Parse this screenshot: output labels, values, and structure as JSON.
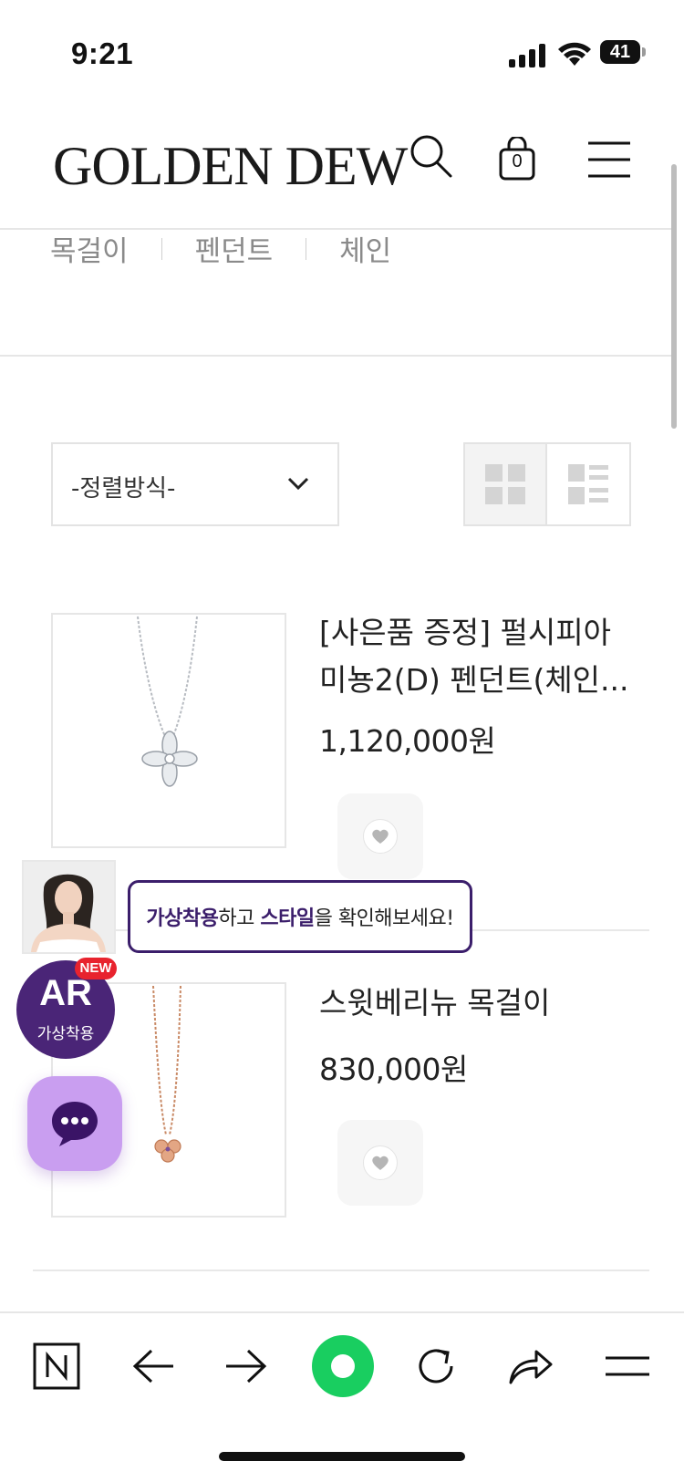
{
  "status_bar": {
    "time": "9:21",
    "battery": "41"
  },
  "header": {
    "logo": "GOLDEN DEW",
    "cart_count": "0"
  },
  "category_nav": {
    "items": [
      "목걸이",
      "펜던트",
      "체인"
    ]
  },
  "sort": {
    "label": "-정렬방식-"
  },
  "products": [
    {
      "name": "[사은품 증정] 펄시피아 미뇽2(D) 펜던트(체인...",
      "price": "1,120,000원"
    },
    {
      "name": "스윗베리뉴 목걸이",
      "price": "830,000원"
    }
  ],
  "ar_promo": {
    "badge_title": "AR",
    "badge_sub": "가상착용",
    "new_badge": "NEW",
    "bubble": {
      "part1": "가상착용",
      "part2": "하고 ",
      "part3": "스타일",
      "part4": "을 확인해보세요!"
    }
  },
  "colors": {
    "ar_purple": "#4a2577",
    "chat_lavender": "#c99ef0",
    "naver_green": "#19ce60",
    "new_red": "#e8232e"
  },
  "icons": [
    "search-icon",
    "bag-icon",
    "menu-icon",
    "chevron-down-icon",
    "grid-view-icon",
    "list-view-icon",
    "heart-icon",
    "chat-icon",
    "naver-n-icon",
    "arrow-left-icon",
    "arrow-right-icon",
    "naver-green-icon",
    "refresh-icon",
    "share-icon",
    "menu-lines-icon"
  ]
}
